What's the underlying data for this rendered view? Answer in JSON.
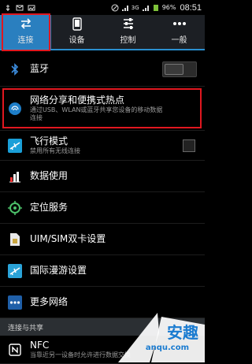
{
  "status_bar": {
    "net_label": "3G",
    "battery": "96%",
    "time": "08:51"
  },
  "tabs": [
    {
      "label": "连接",
      "icon": "arrows-exchange-icon",
      "active": true
    },
    {
      "label": "设备",
      "icon": "phone-device-icon",
      "active": false
    },
    {
      "label": "控制",
      "icon": "sliders-icon",
      "active": false
    },
    {
      "label": "一般",
      "icon": "more-dots-icon",
      "active": false
    }
  ],
  "list": {
    "bluetooth": {
      "title": "蓝牙",
      "icon": "bluetooth-icon"
    },
    "tethering": {
      "title": "网络分享和便携式热点",
      "subtitle_line1": "通过USB、WLAN或蓝牙共享您设备的移动数据",
      "subtitle_line2": "连接",
      "icon": "hotspot-icon"
    },
    "airplane": {
      "title": "飞行模式",
      "subtitle": "禁用所有无线连接",
      "icon": "airplane-icon"
    },
    "data_usage": {
      "title": "数据使用",
      "icon": "data-usage-icon"
    },
    "location": {
      "title": "定位服务",
      "icon": "location-icon"
    },
    "dual_sim": {
      "title": "UIM/SIM双卡设置",
      "icon": "sim-card-icon"
    },
    "roaming": {
      "title": "国际漫游设置",
      "icon": "roaming-plane-icon"
    },
    "more_networks": {
      "title": "更多网络",
      "icon": "more-networks-icon"
    },
    "section_header": "连接与共享",
    "nfc": {
      "title": "NFC",
      "subtitle": "当靠近另一设备时允许进行数据交换",
      "icon": "nfc-icon"
    }
  },
  "watermark": {
    "text": "安趣",
    "url": "anqu.com"
  },
  "colors": {
    "accent": "#2a7fbf",
    "highlight": "#e0171f",
    "background": "#000000"
  }
}
